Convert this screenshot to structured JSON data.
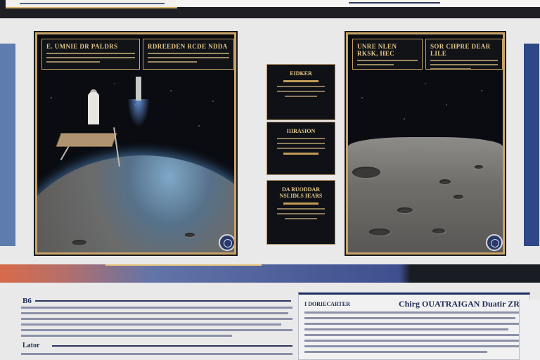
{
  "header": {
    "left_panel": "",
    "right_panel": ""
  },
  "panels": [
    {
      "caption_left": "E. UMNIE DR PALDRS",
      "caption_right": "RDREEDEN RCDE NDDA"
    },
    {
      "caption_left": "UNRE NLEN RKSK, HEC",
      "caption_right": "SOR CHPRE DEAR LILE"
    }
  ],
  "cards": [
    {
      "title": "EIDKER"
    },
    {
      "title": "IIIRASION"
    },
    {
      "title": "DA RUODDAR NSLIDLS IEARS"
    }
  ],
  "document": {
    "left_heading": "B6",
    "left_subheading": "Lator",
    "right_kicker": "I DORIECARTER",
    "right_title": "Chirg OUATRAIGAN Duatir ZRICE"
  },
  "colors": {
    "accent_gold": "#c9a467",
    "navy": "#2f4788",
    "divider_red": "#d86a4a"
  }
}
